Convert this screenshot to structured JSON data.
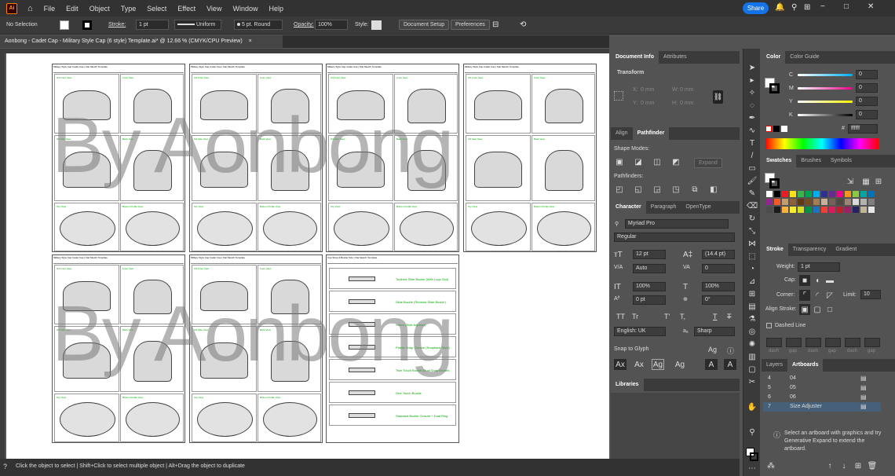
{
  "menu": {
    "logo": "Ai",
    "items": [
      "File",
      "Edit",
      "Object",
      "Type",
      "Select",
      "Effect",
      "View",
      "Window",
      "Help"
    ],
    "share": "Share"
  },
  "control": {
    "selection": "No Selection",
    "stroke_label": "Stroke:",
    "stroke_weight": "1 pt",
    "profile": "Uniform",
    "brush": "5 pt. Round",
    "opacity_label": "Opacity:",
    "opacity": "100%",
    "style_label": "Style:",
    "doc_setup": "Document Setup",
    "preferences": "Preferences"
  },
  "document": {
    "tab_title": "Aonbong - Cadet Cap - Military Style Cap (6 style) Template.ai* @ 12.66 % (CMYK/CPU Preview)",
    "close": "×"
  },
  "canvas": {
    "watermark_top": "By Aonbong",
    "watermark_bottom": "By Aonbong",
    "board_header": "Military Style Cap Cadet Cap | Flat Sketch Template",
    "board_brand": "By Aonbong",
    "sizes_header": "Cap Strap & Buckle Size | Flat Sketch Template",
    "views": [
      "3/4 Front View",
      "Front View",
      "3/4 Side View",
      "Back View",
      "Top View",
      "Bottom Profile View"
    ],
    "buckles": [
      "Toothed Slide Buckle (With Logo Slot)",
      "Slide Buckle (Reverse Slide Buckle)",
      "Velcro (Side Adjuster)",
      "Plastic Snap Closure (Snapback Style)",
      "Twin Touch Buckle (Dual Snap Buckle)",
      "One-Touch Buckle",
      "Standard Buckle Closure + Dual Ring"
    ]
  },
  "status": {
    "text": "Click the object to select  |  Shift+Click to select multiple object  |  Alt+Drag the object to duplicate"
  },
  "doc_panel": {
    "tabs": [
      "Document Info",
      "Attributes"
    ],
    "transform": "Transform",
    "x": "X:",
    "y": "Y:",
    "w": "W:",
    "h": "H:",
    "x_val": "0 mm",
    "y_val": "0 mm",
    "w_val": "0 mm",
    "h_val": "0 mm"
  },
  "pathfinder": {
    "tabs": [
      "Align",
      "Pathfinder"
    ],
    "shape_modes": "Shape Modes:",
    "pathfinders": "Pathfinders:",
    "expand": "Expand"
  },
  "character": {
    "tabs": [
      "Character",
      "Paragraph",
      "OpenType"
    ],
    "font": "Myriad Pro",
    "style": "Regular",
    "size": "12 pt",
    "leading": "(14.4 pt)",
    "kerning": "Auto",
    "tracking": "0",
    "vscale": "100%",
    "hscale": "100%",
    "baseline": "0 pt",
    "rotation": "0°",
    "language": "English: UK",
    "aa": "Sharp",
    "snap": "Snap to Glyph",
    "tt1": "TT",
    "tt2": "Tr",
    "tt3": "T'",
    "tt4": "T,",
    "tt5": "T",
    "tt6": "T"
  },
  "libraries": {
    "title": "Libraries"
  },
  "color_panel": {
    "tabs": [
      "Color",
      "Color Guide"
    ],
    "c": "C",
    "m": "M",
    "y": "Y",
    "k": "K",
    "c_val": "0",
    "m_val": "0",
    "y_val": "0",
    "k_val": "0",
    "hex_label": "#",
    "hex": "ffffff"
  },
  "swatches": {
    "tabs": [
      "Swatches",
      "Brushes",
      "Symbols"
    ],
    "colors": [
      "#ffffff",
      "#000000",
      "#ed1c24",
      "#ffde17",
      "#39b54a",
      "#00a651",
      "#00aeef",
      "#2e3192",
      "#662d91",
      "#ec008c",
      "#f7941d",
      "#8dc63f",
      "#00a79d",
      "#0072bc",
      "#92278f",
      "#f15a24",
      "#c69c6d",
      "#8c6239",
      "#603913",
      "#754c24",
      "#a67c52",
      "#c7b299",
      "#736357",
      "#534741",
      "#998675",
      "#d9d9d9",
      "#b3b3b3",
      "#808080",
      "#4d4d4d",
      "#1a1a1a",
      "#fbb040",
      "#f9ed32",
      "#d7df23",
      "#009444",
      "#1c75bc",
      "#ef4136",
      "#da1c5c",
      "#be1e2d",
      "#9e1f63",
      "#262262",
      "#c2b59b",
      "#e6e7e8"
    ]
  },
  "stroke_panel": {
    "tabs": [
      "Stroke",
      "Transparency",
      "Gradient"
    ],
    "weight_label": "Weight:",
    "weight": "1 pt",
    "cap_label": "Cap:",
    "corner_label": "Corner:",
    "limit_label": "Limit:",
    "limit": "10",
    "align_label": "Align Stroke:",
    "dashed": "Dashed Line",
    "dash": "dash",
    "gap": "gap"
  },
  "artboards": {
    "tabs": [
      "Layers",
      "Artboards"
    ],
    "rows": [
      {
        "num": "4",
        "name": "04"
      },
      {
        "num": "5",
        "name": "05"
      },
      {
        "num": "6",
        "name": "06"
      },
      {
        "num": "7",
        "name": "Size Adjuster"
      }
    ],
    "info": "Select an artboard with graphics and try Generative Expand to extend the artboard."
  }
}
